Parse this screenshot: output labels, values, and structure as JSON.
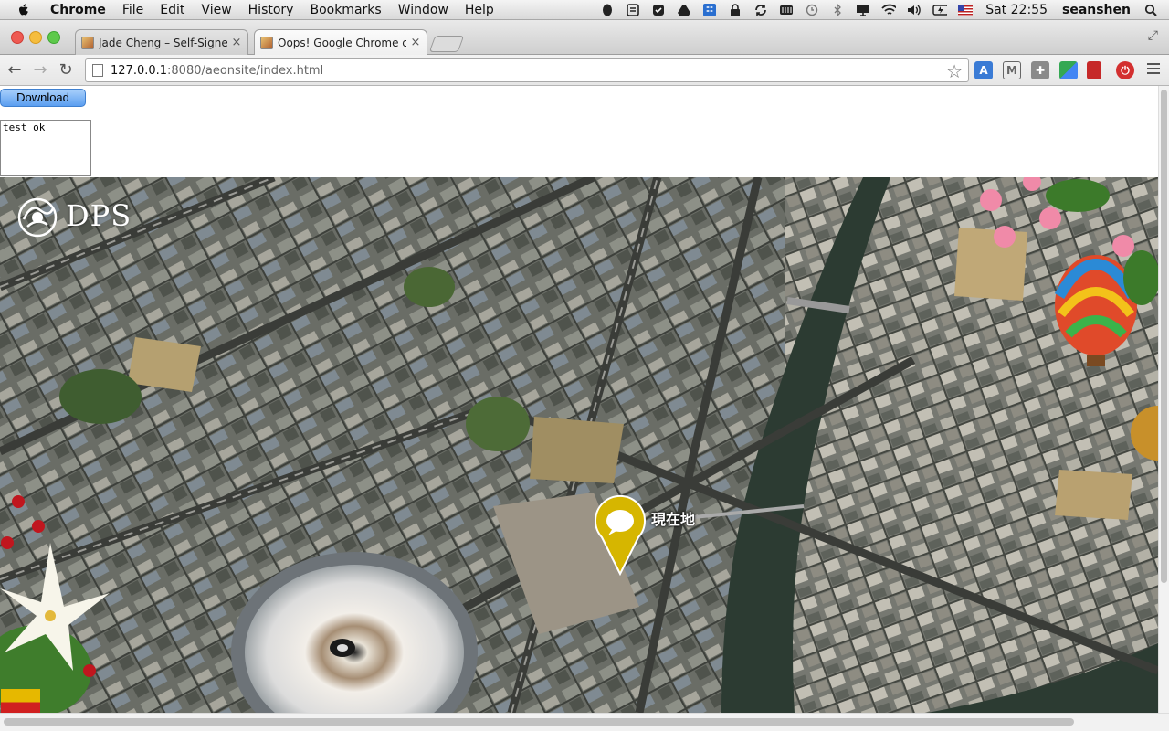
{
  "menubar": {
    "app_name": "Chrome",
    "items": [
      "File",
      "Edit",
      "View",
      "History",
      "Bookmarks",
      "Window",
      "Help"
    ],
    "clock": "Sat 22:55",
    "user": "seanshen"
  },
  "tabs": [
    {
      "title": "Jade Cheng – Self-Signed A",
      "active": false
    },
    {
      "title": "Oops! Google Chrome cou",
      "active": true
    }
  ],
  "toolbar": {
    "url_host": "127.0.0.1",
    "url_rest": ":8080/aeonsite/index.html"
  },
  "page": {
    "download_label": "Download",
    "output_text": "test ok",
    "logo_text": "DPS",
    "pin_label": "現在地"
  },
  "colors": {
    "pin": "#d6b600",
    "river": "#2c3b32",
    "button": "#5b9ef0"
  }
}
